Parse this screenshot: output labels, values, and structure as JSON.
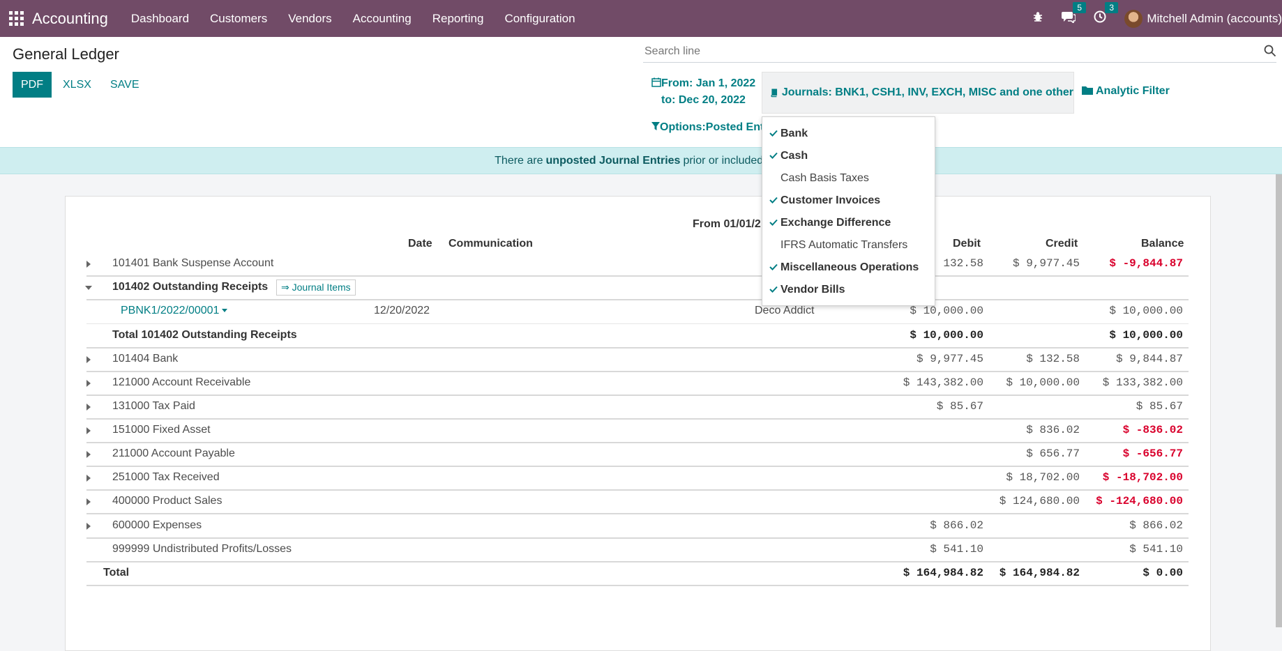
{
  "navbar": {
    "app_title": "Accounting",
    "menu": [
      "Dashboard",
      "Customers",
      "Vendors",
      "Accounting",
      "Reporting",
      "Configuration"
    ],
    "messages_badge": "5",
    "activities_badge": "3",
    "user_name": "Mitchell Admin (accounts)",
    "icons": [
      "apps-grid-icon",
      "bug-icon",
      "chat-icon",
      "clock-icon"
    ]
  },
  "page": {
    "title": "General Ledger",
    "buttons": {
      "pdf": "PDF",
      "xlsx": "XLSX",
      "save": "SAVE"
    },
    "search_placeholder": "Search line"
  },
  "filters": {
    "date_from": "From: Jan 1, 2022",
    "date_to": "to: Dec 20, 2022",
    "journals": "Journals: BNK1, CSH1, INV, EXCH, MISC and one other",
    "analytic": "Analytic Filter",
    "options": "Options:Posted Ent"
  },
  "journals_dropdown": [
    {
      "label": "Bank",
      "selected": true
    },
    {
      "label": "Cash",
      "selected": true
    },
    {
      "label": "Cash Basis Taxes",
      "selected": false
    },
    {
      "label": "Customer Invoices",
      "selected": true
    },
    {
      "label": "Exchange Difference",
      "selected": true
    },
    {
      "label": "IFRS Automatic Transfers",
      "selected": false
    },
    {
      "label": "Miscellaneous Operations",
      "selected": true
    },
    {
      "label": "Vendor Bills",
      "selected": true
    }
  ],
  "alert": {
    "prefix": "There are",
    "link": "unposted Journal Entries",
    "suffix": "prior or included in th"
  },
  "report": {
    "heading": "From 01/01/2",
    "columns": {
      "date": "Date",
      "communication": "Communication",
      "debit": "Debit",
      "credit": "Credit",
      "balance": "Balance"
    },
    "journal_items_btn": "⇒ Journal Items",
    "accounts": [
      {
        "name": "101401 Bank Suspense Account",
        "debit": "132.58",
        "credit": "$ 9,977.45",
        "balance": "$ -9,844.87",
        "negative": true
      },
      {
        "name": "101402 Outstanding Receipts",
        "debit": "",
        "credit": "",
        "balance": "",
        "expanded": true
      },
      {
        "name": "PBNK1/2022/00001",
        "date": "12/20/2022",
        "partner": "Deco Addict",
        "debit": "$ 10,000.00",
        "credit": "",
        "balance": "$ 10,000.00"
      },
      {
        "name": "Total 101402 Outstanding Receipts",
        "debit": "$ 10,000.00",
        "credit": "",
        "balance": "$ 10,000.00"
      },
      {
        "name": "101404 Bank",
        "debit": "$ 9,977.45",
        "credit": "$ 132.58",
        "balance": "$ 9,844.87"
      },
      {
        "name": "121000 Account Receivable",
        "debit": "$ 143,382.00",
        "credit": "$ 10,000.00",
        "balance": "$ 133,382.00"
      },
      {
        "name": "131000 Tax Paid",
        "debit": "$ 85.67",
        "credit": "",
        "balance": "$ 85.67"
      },
      {
        "name": "151000 Fixed Asset",
        "debit": "",
        "credit": "$ 836.02",
        "balance": "$ -836.02",
        "negative": true
      },
      {
        "name": "211000 Account Payable",
        "debit": "",
        "credit": "$ 656.77",
        "balance": "$ -656.77",
        "negative": true
      },
      {
        "name": "251000 Tax Received",
        "debit": "",
        "credit": "$ 18,702.00",
        "balance": "$ -18,702.00",
        "negative": true
      },
      {
        "name": "400000 Product Sales",
        "debit": "",
        "credit": "$ 124,680.00",
        "balance": "$ -124,680.00",
        "negative": true
      },
      {
        "name": "600000 Expenses",
        "debit": "$ 866.02",
        "credit": "",
        "balance": "$ 866.02"
      },
      {
        "name": "999999 Undistributed Profits/Losses",
        "debit": "$ 541.10",
        "credit": "",
        "balance": "$ 541.10"
      }
    ],
    "total": {
      "label": "Total",
      "debit": "$ 164,984.82",
      "credit": "$ 164,984.82",
      "balance": "$ 0.00"
    }
  },
  "colors": {
    "brand": "#714B67",
    "accent": "#017E84",
    "negative": "#d9002c",
    "alert_bg": "#cfeef0"
  }
}
